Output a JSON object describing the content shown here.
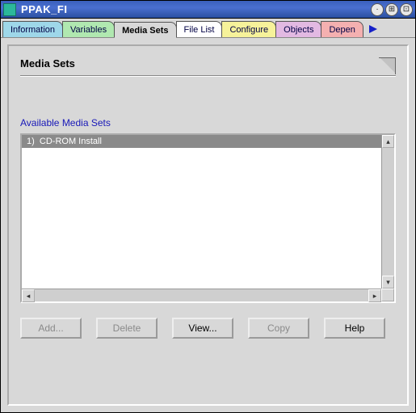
{
  "window": {
    "title": "PPAK_FI"
  },
  "tabs": {
    "information": "Information",
    "variables": "Variables",
    "media_sets": "Media Sets",
    "file_list": "File List",
    "configure": "Configure",
    "objects": "Objects",
    "dependencies": "Depen"
  },
  "panel": {
    "title": "Media Sets",
    "section_label": "Available Media Sets"
  },
  "list": {
    "items": [
      {
        "index": "1)",
        "label": "CD-ROM Install"
      }
    ]
  },
  "buttons": {
    "add": "Add...",
    "delete": "Delete",
    "view": "View...",
    "copy": "Copy",
    "help": "Help"
  }
}
